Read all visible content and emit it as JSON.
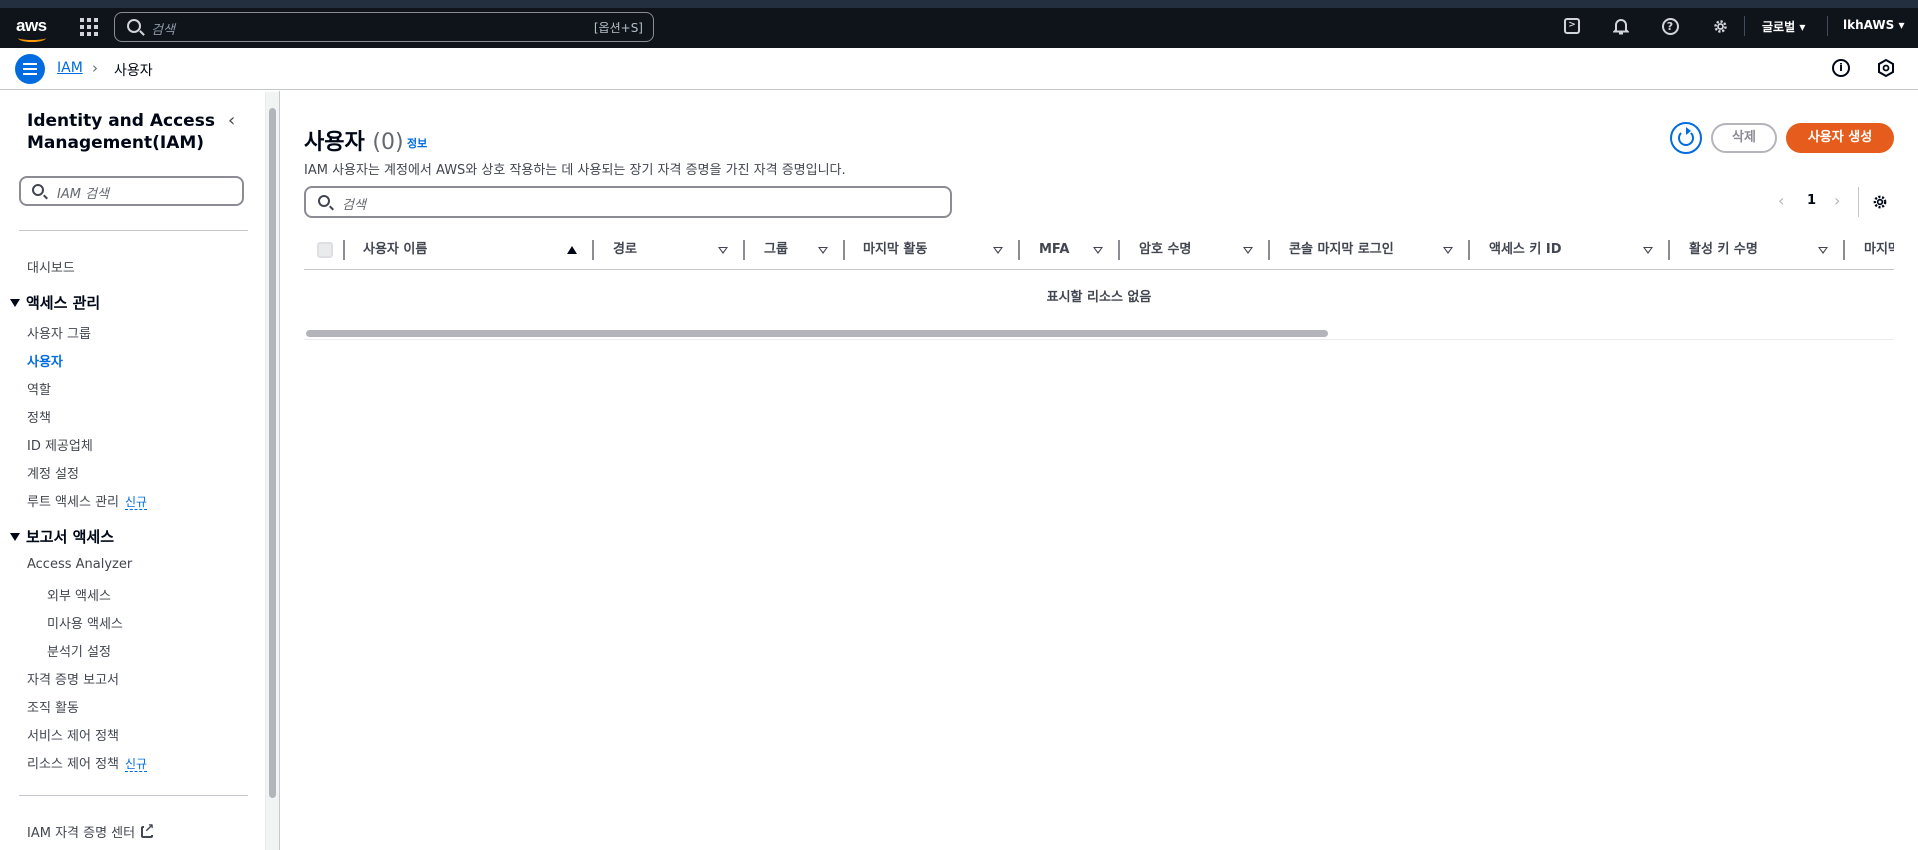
{
  "topnav": {
    "search_placeholder": "검색",
    "search_shortcut": "[옵션+S]",
    "region": "글로벌",
    "account": "lkhAWS"
  },
  "breadcrumb": {
    "root": "IAM",
    "current": "사용자"
  },
  "sidebar": {
    "title": "Identity and Access Management(IAM)",
    "search_placeholder": "IAM 검색",
    "dashboard": "대시보드",
    "access_section": "액세스 관리",
    "access_items": [
      "사용자 그룹",
      "사용자",
      "역할",
      "정책",
      "ID 제공업체",
      "계정 설정",
      "루트 액세스 관리"
    ],
    "active_item": "사용자",
    "new_badge": "신규",
    "report_section": "보고서 액세스",
    "report_items": [
      "Access Analyzer",
      "외부 액세스",
      "미사용 액세스",
      "분석기 설정",
      "자격 증명 보고서",
      "조직 활동",
      "서비스 제어 정책",
      "리소스 제어 정책"
    ],
    "footer_link": "IAM 자격 증명 센터"
  },
  "main": {
    "title": "사용자",
    "count": "(0)",
    "info_link": "정보",
    "description": "IAM 사용자는 계정에서 AWS와 상호 작용하는 데 사용되는 장기 자격 증명을 가진 자격 증명입니다.",
    "delete_label": "삭제",
    "create_label": "사용자 생성",
    "search_placeholder": "검색",
    "page_number": "1",
    "columns": [
      "사용자 이름",
      "경로",
      "그룹",
      "마지막 활동",
      "MFA",
      "암호 수명",
      "콘솔 마지막 로그인",
      "액세스 키 ID",
      "활성 키 수명",
      "마지막"
    ],
    "empty_message": "표시할 리소스 없음"
  },
  "colors": {
    "topbar": "#0f141a",
    "link": "#006ce0",
    "primary_button": "#e65c1c"
  }
}
